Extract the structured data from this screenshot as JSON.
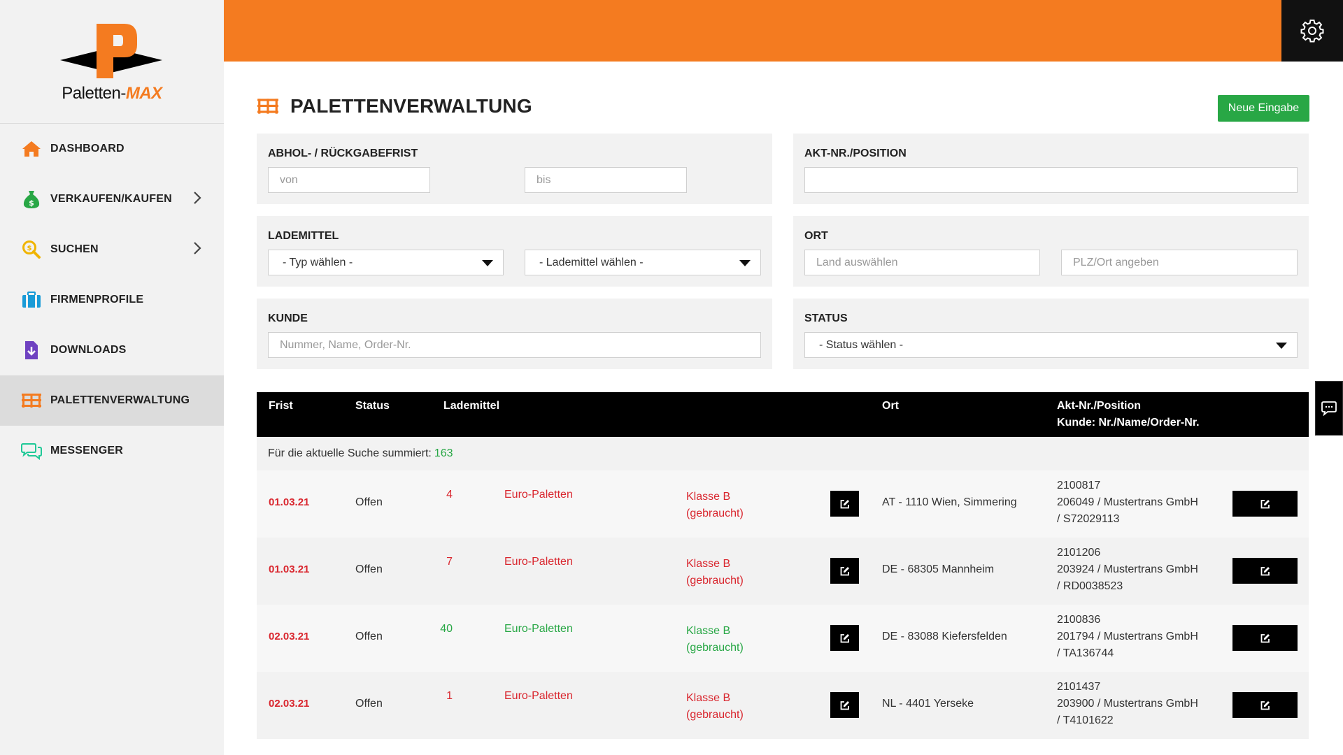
{
  "brand": {
    "logo_text": "Paletten-",
    "logo_max": "MAX"
  },
  "sidebar": {
    "items": [
      {
        "label": "DASHBOARD",
        "icon": "home-icon",
        "color": "#f47b20"
      },
      {
        "label": "VERKAUFEN/KAUFEN",
        "icon": "money-bag-icon",
        "color": "#28a745",
        "chevron": true
      },
      {
        "label": "SUCHEN",
        "icon": "search-icon",
        "color": "#f0b400",
        "chevron": true
      },
      {
        "label": "FIRMENPROFILE",
        "icon": "briefcase-icon",
        "color": "#1a9bd7"
      },
      {
        "label": "DOWNLOADS",
        "icon": "download-file-icon",
        "color": "#6f42c1"
      },
      {
        "label": "PALETTENVERWALTUNG",
        "icon": "pallet-icon",
        "color": "#f47b20",
        "active": true
      },
      {
        "label": "MESSENGER",
        "icon": "chat-bubbles-icon",
        "color": "#20c997"
      }
    ]
  },
  "header": {
    "title": "PALETTENVERWALTUNG",
    "new_button": "Neue Eingabe"
  },
  "filters": {
    "frist": {
      "label": "ABHOL- / RÜCKGABEFRIST",
      "from_placeholder": "von",
      "to_placeholder": "bis"
    },
    "akt": {
      "label": "AKT-NR./POSITION",
      "placeholder": ""
    },
    "lademittel": {
      "label": "LADEMITTEL",
      "typ": "- Typ wählen -",
      "lademittel": "- Lademittel wählen -"
    },
    "ort": {
      "label": "ORT",
      "land_placeholder": "Land auswählen",
      "plz_placeholder": "PLZ/Ort angeben"
    },
    "kunde": {
      "label": "KUNDE",
      "placeholder": "Nummer, Name, Order-Nr."
    },
    "status": {
      "label": "STATUS",
      "value": "- Status wählen -"
    }
  },
  "table": {
    "headers": {
      "frist": "Frist",
      "status": "Status",
      "lademittel": "Lademittel",
      "ort": "Ort",
      "akt_line1": "Akt-Nr./Position",
      "akt_line2": "Kunde: Nr./Name/Order-Nr."
    },
    "summary_label": "Für die aktuelle Suche summiert:",
    "summary_count": "163",
    "rows": [
      {
        "frist": "01.03.21",
        "status": "Offen",
        "qty": "4",
        "type": "Euro-Paletten",
        "klasse1": "Klasse B",
        "klasse2": "(gebraucht)",
        "tone": "red",
        "ort": "AT - 1110 Wien, Simmering",
        "akt1": "2100817",
        "akt2": "206049 / Mustertrans GmbH",
        "akt3": "/ S72029113"
      },
      {
        "frist": "01.03.21",
        "status": "Offen",
        "qty": "7",
        "type": "Euro-Paletten",
        "klasse1": "Klasse B",
        "klasse2": "(gebraucht)",
        "tone": "red",
        "ort": "DE - 68305 Mannheim",
        "akt1": "2101206",
        "akt2": "203924 / Mustertrans GmbH",
        "akt3": "/ RD0038523"
      },
      {
        "frist": "02.03.21",
        "status": "Offen",
        "qty": "40",
        "type": "Euro-Paletten",
        "klasse1": "Klasse B",
        "klasse2": "(gebraucht)",
        "tone": "green",
        "ort": "DE - 83088 Kiefersfelden",
        "akt1": "2100836",
        "akt2": "201794 / Mustertrans GmbH",
        "akt3": "/ TA136744"
      },
      {
        "frist": "02.03.21",
        "status": "Offen",
        "qty": "1",
        "type": "Euro-Paletten",
        "klasse1": "Klasse B",
        "klasse2": "(gebraucht)",
        "tone": "red",
        "ort": "NL - 4401 Yerseke",
        "akt1": "2101437",
        "akt2": "203900 / Mustertrans GmbH",
        "akt3": "/ T4101622"
      }
    ]
  },
  "colors": {
    "brand_orange": "#f47b20",
    "accent_red": "#d9262e",
    "accent_green": "#28a745"
  }
}
